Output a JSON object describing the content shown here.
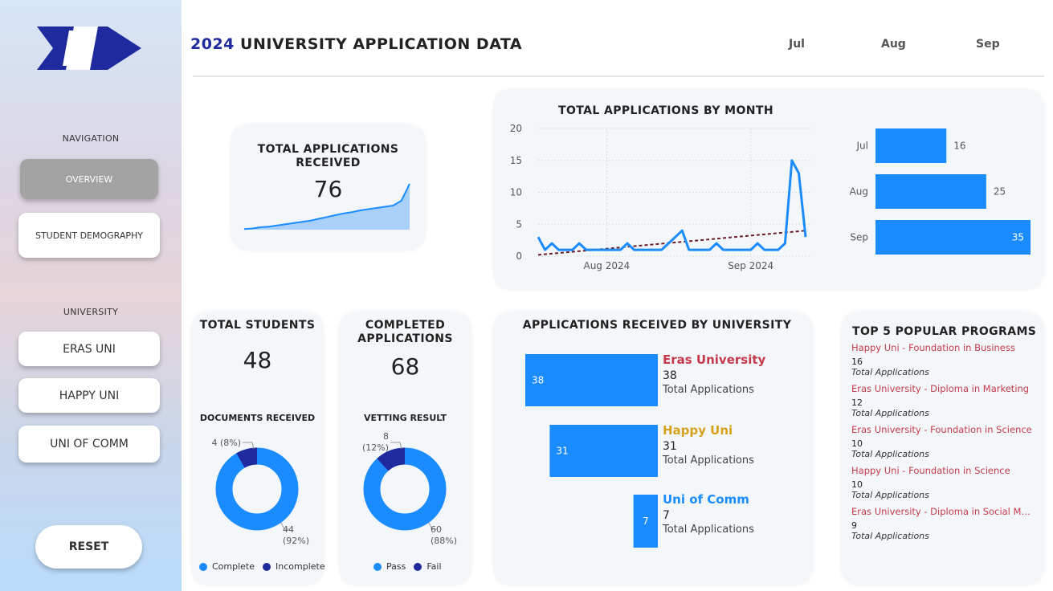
{
  "header": {
    "year": "2024",
    "title": "UNIVERSITY APPLICATION DATA",
    "months": [
      "Jul",
      "Aug",
      "Sep"
    ]
  },
  "sidebar": {
    "navigation_label": "NAVIGATION",
    "nav_items": [
      "OVERVIEW",
      "STUDENT DEMOGRAPHY"
    ],
    "university_label": "UNIVERSITY",
    "universities": [
      "ERAS UNI",
      "HAPPY UNI",
      "UNI OF COMM"
    ],
    "reset_label": "RESET"
  },
  "total_applications": {
    "title": "TOTAL APPLICATIONS RECEIVED",
    "value": "76"
  },
  "total_students": {
    "title": "TOTAL STUDENTS",
    "value": "48",
    "donut_title": "DOCUMENTS RECEIVED",
    "small_label": "4 (8%)",
    "big_label_1": "44",
    "big_label_2": "(92%)",
    "legend": [
      "Complete",
      "Incomplete"
    ]
  },
  "completed_applications": {
    "title": "COMPLETED APPLICATIONS",
    "value": "68",
    "donut_title": "VETTING RESULT",
    "small_label_1": "8",
    "small_label_2": "(12%)",
    "big_label_1": "60",
    "big_label_2": "(88%)",
    "legend": [
      "Pass",
      "Fail"
    ]
  },
  "by_university": {
    "title": "APPLICATIONS RECEIVED BY UNIVERSITY",
    "items": [
      {
        "name": "Eras University",
        "value": "38",
        "sub": "Total Applications"
      },
      {
        "name": "Happy Uni",
        "value": "31",
        "sub": "Total Applications"
      },
      {
        "name": "Uni of Comm",
        "value": "7",
        "sub": "Total Applications"
      }
    ]
  },
  "top_programs": {
    "title": "TOP 5 POPULAR PROGRAMS",
    "items": [
      {
        "name": "Happy Uni - Foundation in Business",
        "value": "16",
        "sub": "Total Applications"
      },
      {
        "name": "Eras University - Diploma in Marketing",
        "value": "12",
        "sub": "Total Applications"
      },
      {
        "name": "Eras University - Foundation in Science",
        "value": "10",
        "sub": "Total Applications"
      },
      {
        "name": "Happy Uni - Foundation in Science",
        "value": "10",
        "sub": "Total Applications"
      },
      {
        "name": "Eras University - Diploma in Social Me...",
        "value": "9",
        "sub": "Total Applications"
      }
    ]
  },
  "colors": {
    "primary": "#1a8cff",
    "dark": "#1e2a9e",
    "eras": "#c43a4a",
    "happy": "#d6a21e",
    "comm": "#1a8cff",
    "trend": "#6b1d2a"
  },
  "chart_data": [
    {
      "type": "area",
      "title": "",
      "x": [
        1,
        2,
        3,
        4,
        5,
        6,
        7,
        8,
        9,
        10,
        11,
        12,
        13,
        14,
        15,
        16,
        17,
        18,
        19,
        20,
        21
      ],
      "values": [
        1,
        2,
        4,
        5,
        7,
        9,
        11,
        13,
        15,
        18,
        21,
        24,
        27,
        29,
        32,
        34,
        36,
        38,
        40,
        48,
        76
      ]
    },
    {
      "type": "line",
      "title": "TOTAL APPLICATIONS BY MONTH",
      "x_tick_labels": [
        "Aug 2024",
        "Sep 2024"
      ],
      "ylim": [
        0,
        20
      ],
      "y_ticks": [
        0,
        5,
        10,
        15,
        20
      ],
      "grid": true,
      "series": [
        {
          "values": [
            3,
            1,
            2,
            1,
            1,
            1,
            2,
            1,
            1,
            1,
            1,
            1,
            1,
            2,
            1,
            1,
            1,
            1,
            1,
            2,
            3,
            4,
            1,
            1,
            1,
            1,
            2,
            1,
            1,
            1,
            1,
            1,
            2,
            1,
            1,
            1,
            2,
            15,
            13,
            3
          ]
        }
      ],
      "trendline": {
        "start": 0.2,
        "end": 4
      }
    },
    {
      "type": "bar",
      "orientation": "horizontal",
      "categories": [
        "Jul",
        "Aug",
        "Sep"
      ],
      "values": [
        16,
        25,
        35
      ]
    },
    {
      "type": "bar",
      "orientation": "horizontal",
      "title": "APPLICATIONS RECEIVED BY UNIVERSITY",
      "categories": [
        "Eras University",
        "Happy Uni",
        "Uni of Comm"
      ],
      "values": [
        38,
        31,
        7
      ]
    },
    {
      "type": "pie",
      "title": "DOCUMENTS RECEIVED",
      "categories": [
        "Complete",
        "Incomplete"
      ],
      "values": [
        44,
        4
      ]
    },
    {
      "type": "pie",
      "title": "VETTING RESULT",
      "categories": [
        "Pass",
        "Fail"
      ],
      "values": [
        60,
        8
      ]
    }
  ]
}
